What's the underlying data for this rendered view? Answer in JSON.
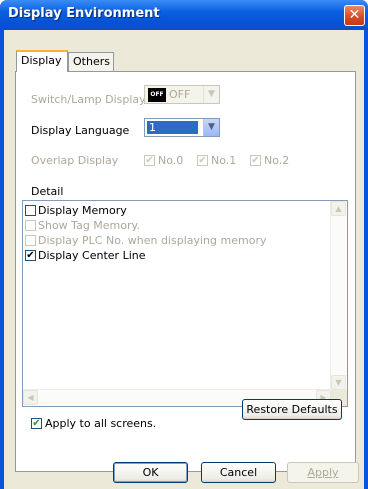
{
  "window": {
    "title": "Display Environment",
    "close_glyph": "✕"
  },
  "tabs": [
    {
      "label": "Display",
      "active": true
    },
    {
      "label": "Others",
      "active": false
    }
  ],
  "switch_lamp": {
    "label": "Switch/Lamp Display",
    "badge": "OFF",
    "value": "OFF",
    "enabled": false
  },
  "display_language": {
    "label": "Display Language",
    "value": "1",
    "enabled": true
  },
  "overlap_display": {
    "label": "Overlap Display",
    "enabled": false,
    "options": [
      {
        "label": "No.0",
        "checked": true
      },
      {
        "label": "No.1",
        "checked": true
      },
      {
        "label": "No.2",
        "checked": true
      }
    ]
  },
  "detail": {
    "label": "Detail",
    "items": [
      {
        "label": "Display Memory",
        "checked": false,
        "enabled": true
      },
      {
        "label": "Show Tag Memory.",
        "checked": false,
        "enabled": false
      },
      {
        "label": "Display PLC No. when displaying memory",
        "checked": false,
        "enabled": false
      },
      {
        "label": "Display Center Line",
        "checked": true,
        "enabled": true
      }
    ]
  },
  "glyphs": {
    "check": "✔",
    "arrow_down": "▼",
    "arrow_up": "▲",
    "arrow_left": "◀",
    "arrow_right": "▶"
  },
  "restore_defaults_label": "Restore Defaults",
  "apply_all": {
    "label": "Apply to all screens.",
    "checked": true
  },
  "buttons": {
    "ok": "OK",
    "cancel": "Cancel",
    "apply": "Apply"
  },
  "colors": {
    "title_bar": "#0a5fe0",
    "dialog_bg": "#ece9d8",
    "selection": "#316ac5",
    "check_mark": "#21a121"
  }
}
